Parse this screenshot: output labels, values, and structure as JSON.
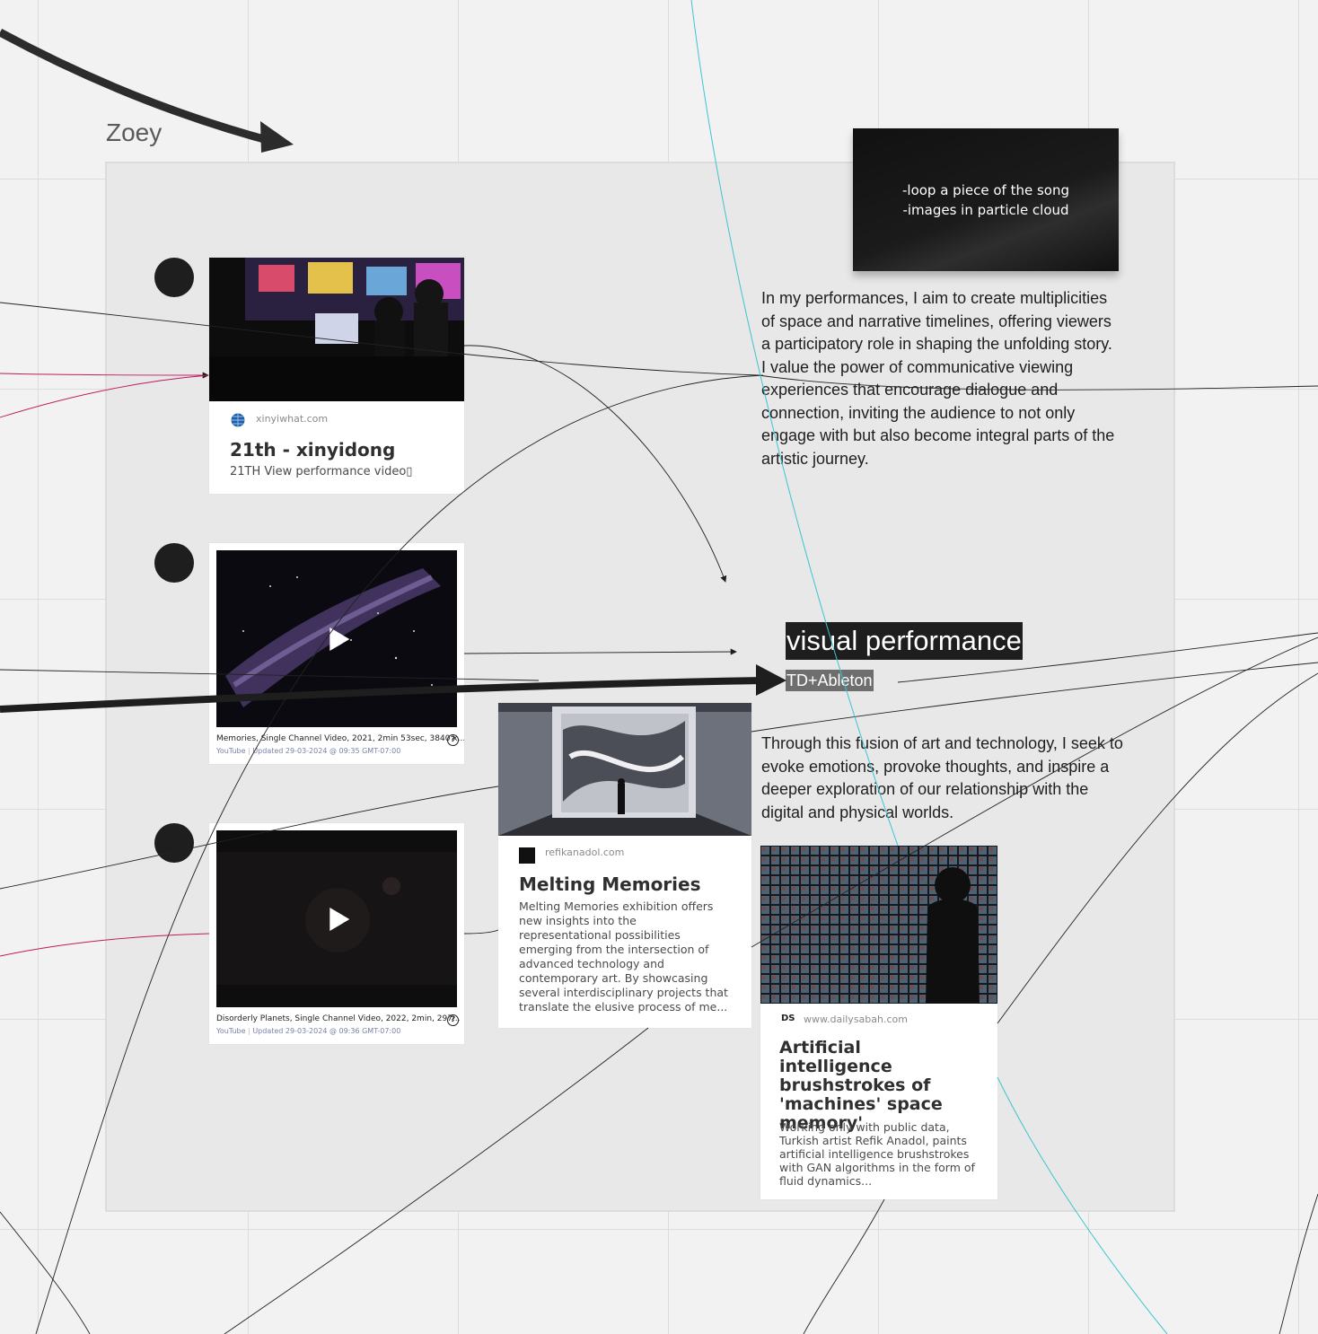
{
  "frame": {
    "title": "Zoey"
  },
  "sticky_note": {
    "line1": "-loop a piece of the song",
    "line2": "-images in particle cloud"
  },
  "paragraph1": "In my performances, I aim to create multiplicities of space and narrative timelines, offering viewers a participatory role in shaping the unfolding story. I value the power of communicative viewing experiences that encourage dialogue and connection, inviting the audience to not only engage with but also become integral parts of the artistic journey.",
  "paragraph2": "Through this fusion of art and technology, I seek to evoke emotions, provoke thoughts, and inspire a deeper exploration of our relationship with the digital and physical worlds.",
  "heading": {
    "title": "visual performance",
    "subtitle": "TD+Ableton"
  },
  "link_card_1": {
    "site": "xinyiwhat.com",
    "title": "21th - xinyidong",
    "description": "21TH View performance video▯"
  },
  "video_1": {
    "caption": "Memories, Single Channel Video, 2021, 2min 53sec, 3840 x...",
    "source": "YouTube",
    "updated": "Updated 29-03-2024 @ 09:35 GMT-07:00"
  },
  "video_2": {
    "caption": "Disorderly Planets,  Single Channel Video, 2022, 2min, 297...",
    "source": "YouTube",
    "updated": "Updated 29-03-2024 @ 09:36 GMT-07:00"
  },
  "link_card_2": {
    "site": "refikanadol.com",
    "title": "Melting Memories",
    "description": "Melting Memories exhibition offers new insights into the representational possibilities emerging from the intersection of advanced technology and contemporary art. By showcasing several interdisciplinary projects that translate the elusive process of me..."
  },
  "link_card_3": {
    "site": "www.dailysabah.com",
    "site_logo": "DS",
    "title": "Artificial intelligence brushstrokes of 'machines' space memory'",
    "description": "Working only with public data, Turkish artist Refik Anadol, paints artificial intelligence brushstrokes with GAN algorithms in the form of fluid dynamics..."
  },
  "icons": {
    "help": "?",
    "globe": "globe-icon",
    "play": "play-icon"
  },
  "colors": {
    "connector_dark": "#1e1e1e",
    "connector_pink": "#c2185b",
    "connector_cyan": "#3cc4d0"
  }
}
